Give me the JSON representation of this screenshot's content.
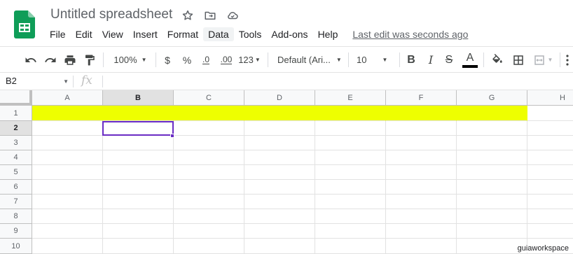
{
  "doc": {
    "title": "Untitled spreadsheet"
  },
  "menu": [
    "File",
    "Edit",
    "View",
    "Insert",
    "Format",
    "Data",
    "Tools",
    "Add-ons",
    "Help"
  ],
  "last_edit": "Last edit was seconds ago",
  "toolbar": {
    "zoom": "100%",
    "currency": "$",
    "percent": "%",
    "decrease_decimals": ".0",
    "increase_decimals": ".00",
    "more_formats": "123",
    "font": "Default (Ari...",
    "font_size": "10",
    "bold": "B",
    "italic": "I",
    "strikethrough": "S",
    "text_color_label": "A"
  },
  "formula_bar": {
    "name_box": "B2",
    "fx_label": "fx",
    "value": ""
  },
  "grid": {
    "columns": [
      "A",
      "B",
      "C",
      "D",
      "E",
      "F",
      "G",
      "H"
    ],
    "rows": [
      "1",
      "2",
      "3",
      "4",
      "5",
      "6",
      "7",
      "8",
      "9",
      "10"
    ],
    "selected_cell": "B2",
    "highlighted_row": "1",
    "highlight_color": "#eeff00",
    "selection_color": "#6a2cc4"
  },
  "watermark": "guiaworkspace"
}
